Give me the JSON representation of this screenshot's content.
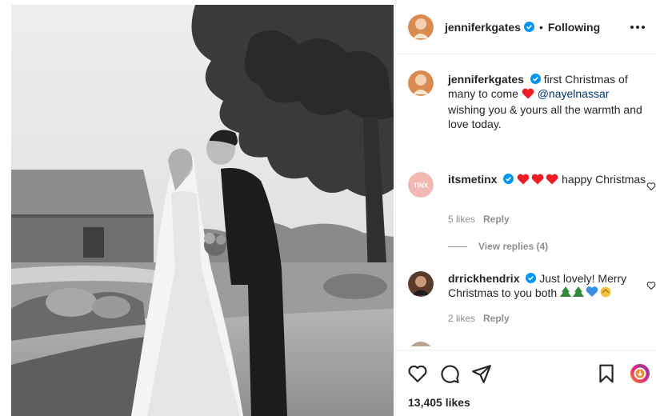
{
  "header": {
    "username": "jenniferkgates",
    "separator": "•",
    "follow_state": "Following"
  },
  "caption": {
    "username": "jenniferkgates",
    "text_before": "first Christmas of many to come",
    "mention": "@nayelnassar",
    "line2": "wishing you & yours all the warmth and love today."
  },
  "comments": [
    {
      "username": "itsmetinx",
      "text": "happy Christmas",
      "likes": "5 likes",
      "reply_label": "Reply",
      "view_replies": "View replies (4)",
      "avatar_text": "TINX"
    },
    {
      "username": "drrickhendrix",
      "text": "Just lovely! Merry Christmas to you both",
      "likes": "2 likes",
      "reply_label": "Reply"
    }
  ],
  "likes_count": "13,405 likes",
  "colors": {
    "verified": "#0095f6",
    "heart_red": "#ed1c24",
    "mention": "#00376b",
    "muted": "#8e8e8e"
  },
  "icons": [
    "heart-icon",
    "comment-icon",
    "share-icon",
    "save-icon",
    "more-icon",
    "verified-icon"
  ]
}
